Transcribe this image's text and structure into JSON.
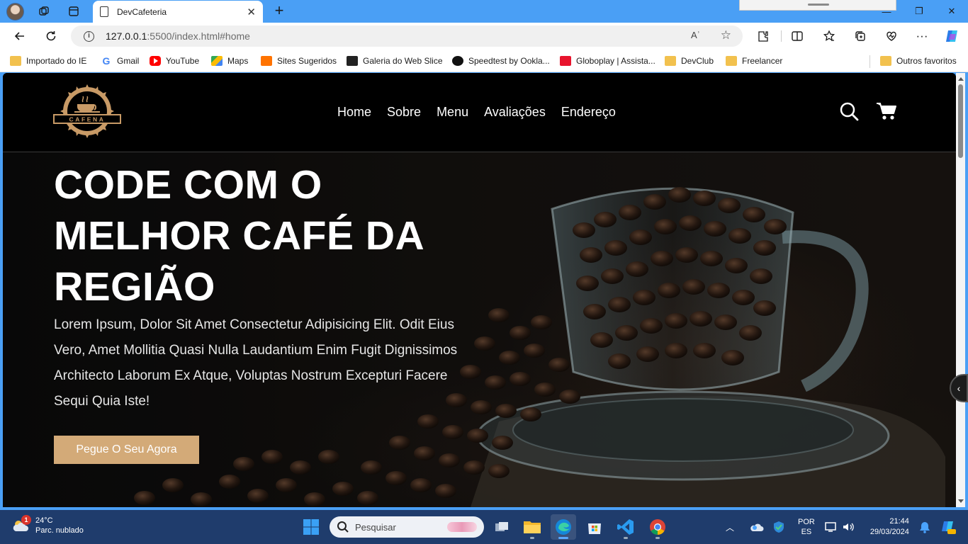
{
  "browser": {
    "tab": {
      "title": "DevCafeteria",
      "close": "✕"
    },
    "new_tab": "+",
    "window_controls": {
      "minimize": "—",
      "maximize": "❐",
      "close": "✕"
    },
    "address": {
      "host": "127.0.0.1",
      "path": ":5500/index.html#home",
      "read_aloud": "Aʾ"
    },
    "favorites": [
      {
        "label": "Importado do IE",
        "icon": "folder-icon"
      },
      {
        "label": "Gmail",
        "icon": "google-icon"
      },
      {
        "label": "YouTube",
        "icon": "youtube-icon"
      },
      {
        "label": "Maps",
        "icon": "maps-icon"
      },
      {
        "label": "Sites Sugeridos",
        "icon": "suggested-sites-icon"
      },
      {
        "label": "Galeria do Web Slice",
        "icon": "web-slice-icon"
      },
      {
        "label": "Speedtest by Ookla...",
        "icon": "speedtest-icon"
      },
      {
        "label": "Globoplay | Assista...",
        "icon": "globoplay-icon"
      },
      {
        "label": "DevClub",
        "icon": "folder-icon"
      },
      {
        "label": "Freelancer",
        "icon": "folder-icon"
      },
      {
        "label": "Outros favoritos",
        "icon": "folder-icon"
      }
    ]
  },
  "site": {
    "logo_text": "CAFENA",
    "nav": [
      "Home",
      "Sobre",
      "Menu",
      "Avaliações",
      "Endereço"
    ],
    "hero": {
      "title": "CODE COM O MELHOR CAFÉ DA REGIÃO",
      "text": "Lorem Ipsum, Dolor Sit Amet Consectetur Adipisicing Elit. Odit Eius Vero, Amet Mollitia Quasi Nulla Laudantium Enim Fugit Dignissimos Architecto Laborum Ex Atque, Voluptas Nostrum Excepturi Facere Sequi Quia Iste!",
      "cta": "Pegue O Seu Agora"
    },
    "colors": {
      "accent": "#d3aa78",
      "background": "#000000"
    }
  },
  "taskbar": {
    "weather": {
      "temp": "24°C",
      "desc": "Parc. nublado",
      "badge": "1"
    },
    "search_placeholder": "Pesquisar",
    "lang": {
      "line1": "POR",
      "line2": "ES"
    },
    "time": "21:44",
    "date": "29/03/2024"
  }
}
